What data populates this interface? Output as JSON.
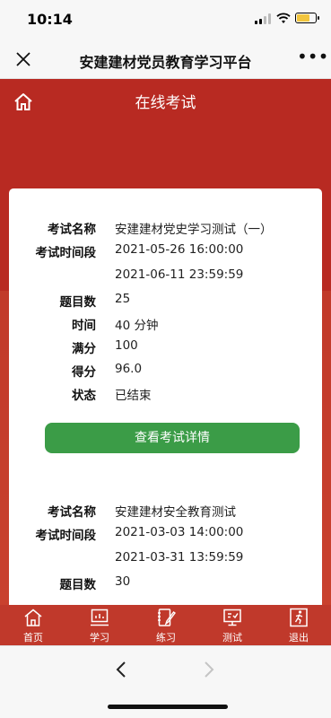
{
  "status_bar": {
    "time": "10:14"
  },
  "wechat_bar": {
    "title": "安建建材党员教育学习平台",
    "more": "•••"
  },
  "header": {
    "title": "在线考试"
  },
  "exams": [
    {
      "fields": [
        {
          "label": "考试名称",
          "value": "安建建材党史学习测试（一）"
        },
        {
          "label": "考试时间段",
          "value": "2021-05-26 16:00:00"
        },
        {
          "label": "",
          "value": "2021-06-11 23:59:59"
        },
        {
          "label": "题目数",
          "value": "25"
        },
        {
          "label": "时间",
          "value": "40 分钟"
        },
        {
          "label": "满分",
          "value": "100"
        },
        {
          "label": "得分",
          "value": "96.0"
        },
        {
          "label": "状态",
          "value": "已结束"
        }
      ],
      "button": "查看考试详情"
    },
    {
      "fields": [
        {
          "label": "考试名称",
          "value": "安建建材安全教育测试"
        },
        {
          "label": "考试时间段",
          "value": "2021-03-03 14:00:00"
        },
        {
          "label": "",
          "value": "2021-03-31 13:59:59"
        },
        {
          "label": "题目数",
          "value": "30"
        }
      ]
    }
  ],
  "tabbar": [
    {
      "label": "首页",
      "icon": "house-icon"
    },
    {
      "label": "学习",
      "icon": "monitor-icon"
    },
    {
      "label": "练习",
      "icon": "notebook-pen-icon"
    },
    {
      "label": "测试",
      "icon": "screen-check-icon"
    },
    {
      "label": "退出",
      "icon": "exit-runner-icon"
    }
  ]
}
